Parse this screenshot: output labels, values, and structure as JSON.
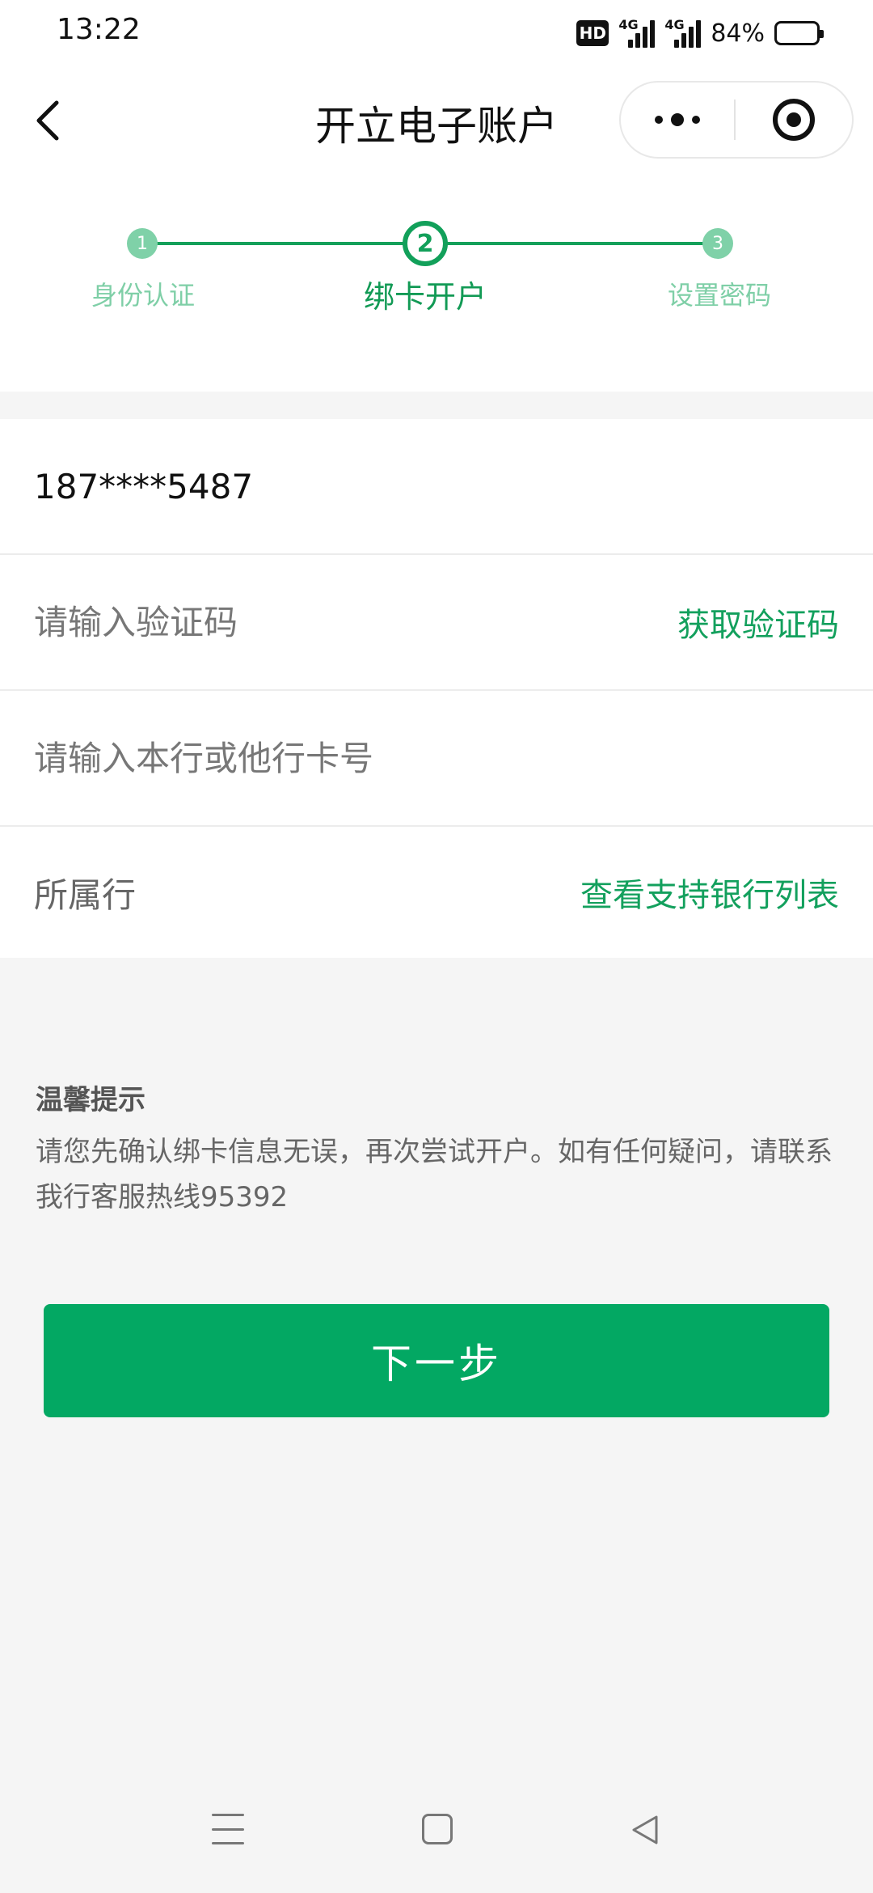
{
  "status_bar": {
    "time": "13:22",
    "hd_label": "HD",
    "network_label": "4G",
    "battery": "84%",
    "battery_level": 0.84
  },
  "nav": {
    "title": "开立电子账户"
  },
  "steps": {
    "current": 2,
    "items": [
      {
        "number": "1",
        "label": "身份认证"
      },
      {
        "number": "2",
        "label": "绑卡开户"
      },
      {
        "number": "3",
        "label": "设置密码"
      }
    ]
  },
  "form": {
    "phone": "187****5487",
    "code_placeholder": "请输入验证码",
    "code_action": "获取验证码",
    "card_placeholder": "请输入本行或他行卡号",
    "bank_label": "所属行",
    "bank_action": "查看支持银行列表"
  },
  "tips": {
    "title": "温馨提示",
    "body": "请您先确认绑卡信息无误，再次尝试开户。如有任何疑问，请联系我行客服热线95392"
  },
  "next_button": "下一步",
  "colors": {
    "accent": "#03a863",
    "step_done": "#7fd1a8",
    "link": "#13a05d"
  }
}
